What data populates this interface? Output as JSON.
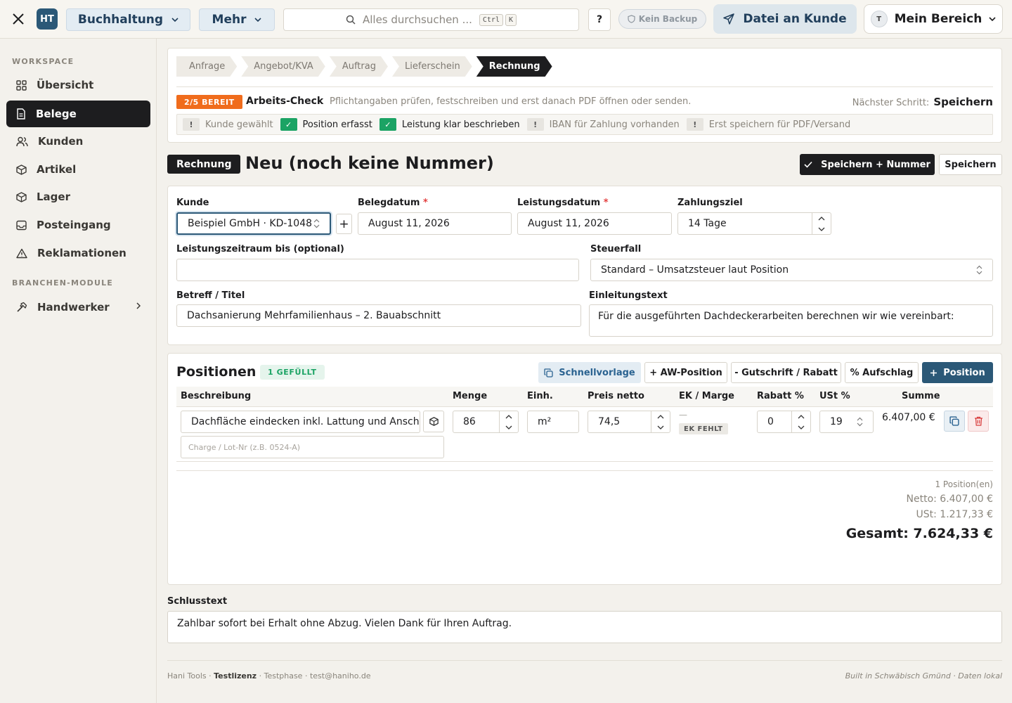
{
  "topbar": {
    "logo": "HT",
    "module_dropdown": "Buchhaltung",
    "more_dropdown": "Mehr",
    "search_placeholder": "Alles durchsuchen ...",
    "kbd_ctrl": "Ctrl",
    "kbd_k": "K",
    "help": "?",
    "backup_status": "Kein Backup",
    "send_button": "Datei an Kunde",
    "user_initial": "T",
    "user_area": "Mein Bereich"
  },
  "sidebar": {
    "workspace_heading": "WORKSPACE",
    "items": [
      {
        "label": "Übersicht",
        "icon": "grid-icon",
        "active": false
      },
      {
        "label": "Belege",
        "icon": "document-icon",
        "active": true
      },
      {
        "label": "Kunden",
        "icon": "users-icon",
        "active": false
      },
      {
        "label": "Artikel",
        "icon": "box-icon",
        "active": false
      },
      {
        "label": "Lager",
        "icon": "box-icon",
        "active": false
      },
      {
        "label": "Posteingang",
        "icon": "inbox-icon",
        "active": false
      },
      {
        "label": "Reklamationen",
        "icon": "warning-icon",
        "active": false
      }
    ],
    "modules_heading": "BRANCHEN-MODULE",
    "module_item": "Handwerker"
  },
  "workflow": {
    "steps": [
      "Anfrage",
      "Angebot/KVA",
      "Auftrag",
      "Lieferschein",
      "Rechnung"
    ],
    "active_step": "Rechnung",
    "ready_badge": "2/5 BEREIT",
    "check_title": "Arbeits-Check",
    "check_subtitle": "Pflichtangaben prüfen, festschreiben und erst danach PDF öffnen oder senden.",
    "next_step_label": "Nächster Schritt:",
    "next_step_value": "Speichern",
    "checks": [
      {
        "label": "Kunde gewählt",
        "status": "pending",
        "mark": "!"
      },
      {
        "label": "Position erfasst",
        "status": "ok",
        "mark": "✓"
      },
      {
        "label": "Leistung klar beschrieben",
        "status": "ok",
        "mark": "✓"
      },
      {
        "label": "IBAN für Zahlung vorhanden",
        "status": "pending",
        "mark": "!"
      },
      {
        "label": "Erst speichern für PDF/Versand",
        "status": "pending",
        "mark": "!"
      }
    ]
  },
  "document": {
    "type_tag": "Rechnung",
    "title": "Neu (noch keine Nummer)",
    "save_number_button": "Speichern + Nummer",
    "save_button": "Speichern"
  },
  "form": {
    "customer_label": "Kunde",
    "customer_value": "Beispiel GmbH · KD-1048",
    "add_customer": "+",
    "doc_date_label": "Belegdatum",
    "doc_date_value": "August 11, 2026",
    "service_date_label": "Leistungsdatum",
    "service_date_value": "August 11, 2026",
    "payment_terms_label": "Zahlungsziel",
    "payment_terms_value": "14 Tage",
    "period_label": "Leistungszeitraum bis (optional)",
    "period_value": "",
    "tax_label": "Steuerfall",
    "tax_value": "Standard – Umsatzsteuer laut Position",
    "subject_label": "Betreff / Titel",
    "subject_value": "Dachsanierung Mehrfamilienhaus – 2. Bauabschnitt",
    "intro_label": "Einleitungstext",
    "intro_value": "Für die ausgeführten Dachdeckerarbeiten berechnen wir wie vereinbart:",
    "required_mark": "*"
  },
  "positions": {
    "title": "Positionen",
    "filled_badge": "1 GEFÜLLT",
    "buttons": {
      "template": "Schnellvorlage",
      "aw": "+ AW-Position",
      "credit": "- Gutschrift / Rabatt",
      "surcharge": "% Aufschlag",
      "add": "Position"
    },
    "columns": [
      "Beschreibung",
      "Menge",
      "Einh.",
      "Preis netto",
      "EK / Marge",
      "Rabatt %",
      "USt %",
      "Summe"
    ],
    "rows": [
      {
        "description": "Dachfläche eindecken inkl. Lattung und Anschlü",
        "lot_placeholder": "Charge / Lot-Nr (z.B. 0524-A)",
        "quantity": "86",
        "unit": "m²",
        "price": "74,5",
        "ek_dash": "—",
        "ek_status": "EK FEHLT",
        "discount": "0",
        "vat": "19",
        "sum": "6.407,00 €"
      }
    ],
    "totals": {
      "count": "1 Position(en)",
      "net": "Netto: 6.407,00 €",
      "vat": "USt: 1.217,33 €",
      "gross": "Gesamt: 7.624,33 €"
    }
  },
  "closing": {
    "label": "Schlusstext",
    "value": "Zahlbar sofort bei Erhalt ohne Abzug. Vielen Dank für Ihren Auftrag."
  },
  "footer": {
    "brand": "Hani Tools",
    "license": "Testlizenz",
    "phase": "Testphase",
    "email": "test@haniho.de",
    "right": "Built in Schwäbisch Gmünd · Daten lokal"
  },
  "colors": {
    "accent": "#2b5877",
    "ok": "#1ba364",
    "warning": "#f06c1c",
    "dark": "#1d1d1f"
  }
}
